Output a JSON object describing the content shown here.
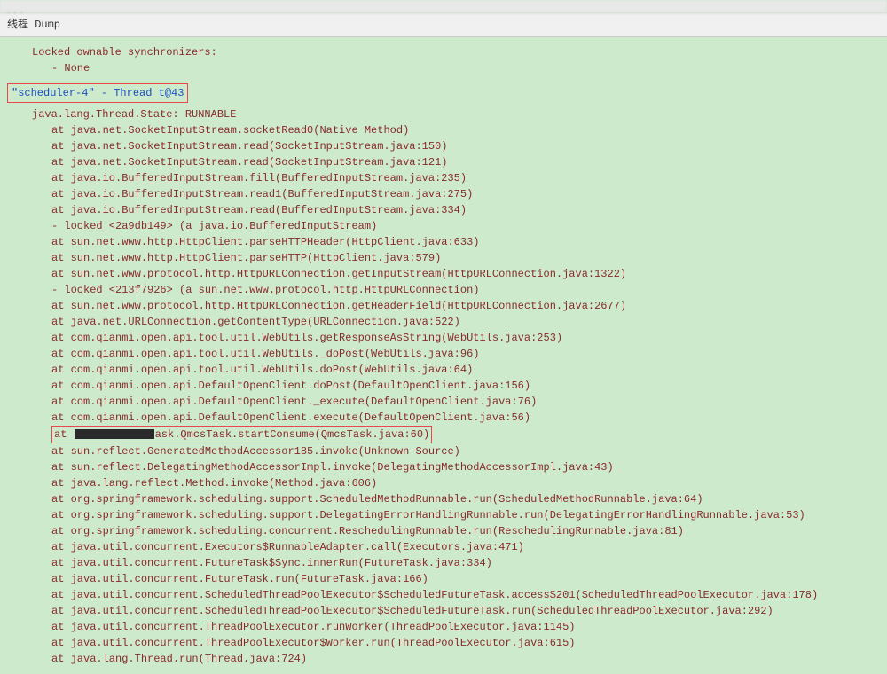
{
  "topBar": "...",
  "tabTitle": "线程 Dump",
  "lockedOwnable": "Locked ownable synchronizers:",
  "noneText": "- None",
  "threadHeader": {
    "name": "\"scheduler-4\"",
    "dash": " - ",
    "tid": "Thread t@43"
  },
  "stateLine": {
    "prefix": "java.lang.Thread.State: ",
    "value": "RUNNABLE"
  },
  "stack": [
    "at java.net.SocketInputStream.socketRead0(Native Method)",
    "at java.net.SocketInputStream.read(SocketInputStream.java:150)",
    "at java.net.SocketInputStream.read(SocketInputStream.java:121)",
    "at java.io.BufferedInputStream.fill(BufferedInputStream.java:235)",
    "at java.io.BufferedInputStream.read1(BufferedInputStream.java:275)",
    "at java.io.BufferedInputStream.read(BufferedInputStream.java:334)",
    "- locked <2a9db149> (a java.io.BufferedInputStream)",
    "at sun.net.www.http.HttpClient.parseHTTPHeader(HttpClient.java:633)",
    "at sun.net.www.http.HttpClient.parseHTTP(HttpClient.java:579)",
    "at sun.net.www.protocol.http.HttpURLConnection.getInputStream(HttpURLConnection.java:1322)",
    "- locked <213f7926> (a sun.net.www.protocol.http.HttpURLConnection)",
    "at sun.net.www.protocol.http.HttpURLConnection.getHeaderField(HttpURLConnection.java:2677)",
    "at java.net.URLConnection.getContentType(URLConnection.java:522)",
    "at com.qianmi.open.api.tool.util.WebUtils.getResponseAsString(WebUtils.java:253)",
    "at com.qianmi.open.api.tool.util.WebUtils._doPost(WebUtils.java:96)",
    "at com.qianmi.open.api.tool.util.WebUtils.doPost(WebUtils.java:64)",
    "at com.qianmi.open.api.DefaultOpenClient.doPost(DefaultOpenClient.java:156)",
    "at com.qianmi.open.api.DefaultOpenClient._execute(DefaultOpenClient.java:76)",
    "at com.qianmi.open.api.DefaultOpenClient.execute(DefaultOpenClient.java:56)"
  ],
  "highlightedStack": {
    "prefix": "at ",
    "suffix": "ask.QmcsTask.startConsume(QmcsTask.java:60)"
  },
  "stack2": [
    "at sun.reflect.GeneratedMethodAccessor185.invoke(Unknown Source)",
    "at sun.reflect.DelegatingMethodAccessorImpl.invoke(DelegatingMethodAccessorImpl.java:43)",
    "at java.lang.reflect.Method.invoke(Method.java:606)",
    "at org.springframework.scheduling.support.ScheduledMethodRunnable.run(ScheduledMethodRunnable.java:64)",
    "at org.springframework.scheduling.support.DelegatingErrorHandlingRunnable.run(DelegatingErrorHandlingRunnable.java:53)",
    "at org.springframework.scheduling.concurrent.ReschedulingRunnable.run(ReschedulingRunnable.java:81)",
    "at java.util.concurrent.Executors$RunnableAdapter.call(Executors.java:471)",
    "at java.util.concurrent.FutureTask$Sync.innerRun(FutureTask.java:334)",
    "at java.util.concurrent.FutureTask.run(FutureTask.java:166)",
    "at java.util.concurrent.ScheduledThreadPoolExecutor$ScheduledFutureTask.access$201(ScheduledThreadPoolExecutor.java:178)",
    "at java.util.concurrent.ScheduledThreadPoolExecutor$ScheduledFutureTask.run(ScheduledThreadPoolExecutor.java:292)",
    "at java.util.concurrent.ThreadPoolExecutor.runWorker(ThreadPoolExecutor.java:1145)",
    "at java.util.concurrent.ThreadPoolExecutor$Worker.run(ThreadPoolExecutor.java:615)",
    "at java.lang.Thread.run(Thread.java:724)"
  ]
}
